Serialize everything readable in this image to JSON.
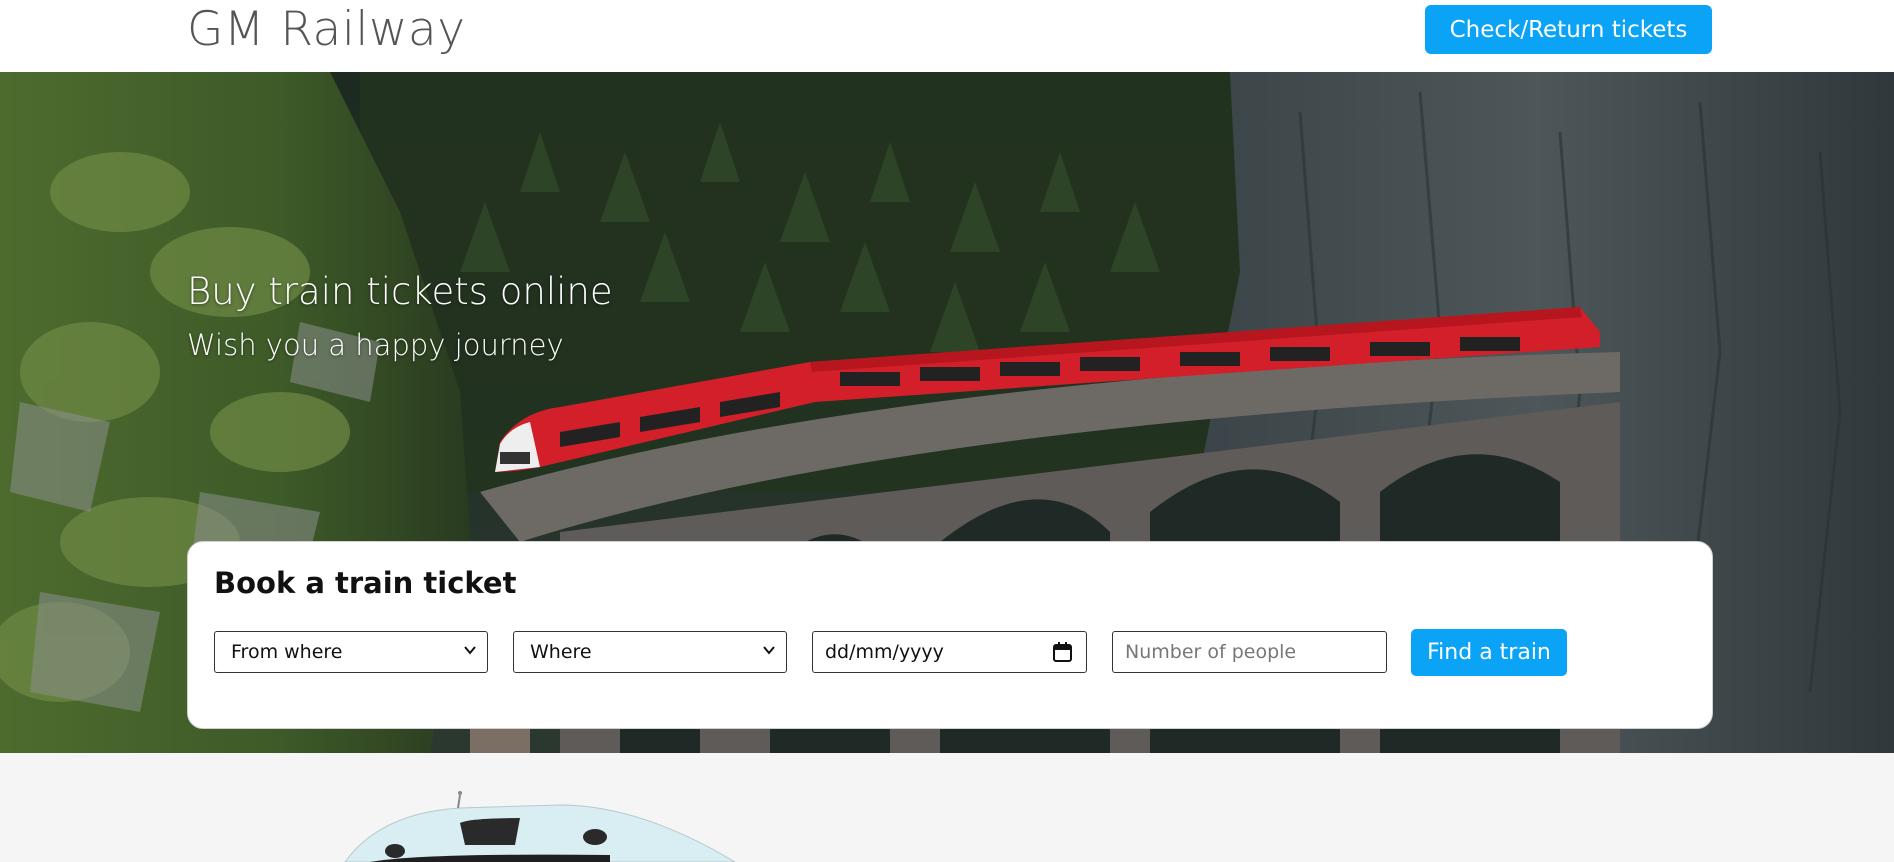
{
  "header": {
    "brand": "GM Railway",
    "check_return_label": "Check/Return tickets"
  },
  "hero": {
    "title": "Buy train tickets online",
    "subtitle": "Wish you a happy journey"
  },
  "booking": {
    "title": "Book a train ticket",
    "from_value": "From where",
    "to_value": "Where",
    "date_value": "dd/mm/yyyy",
    "people_placeholder": "Number of people",
    "find_label": "Find a train"
  },
  "colors": {
    "accent": "#0aa3f5",
    "train_red": "#d21f2a"
  }
}
